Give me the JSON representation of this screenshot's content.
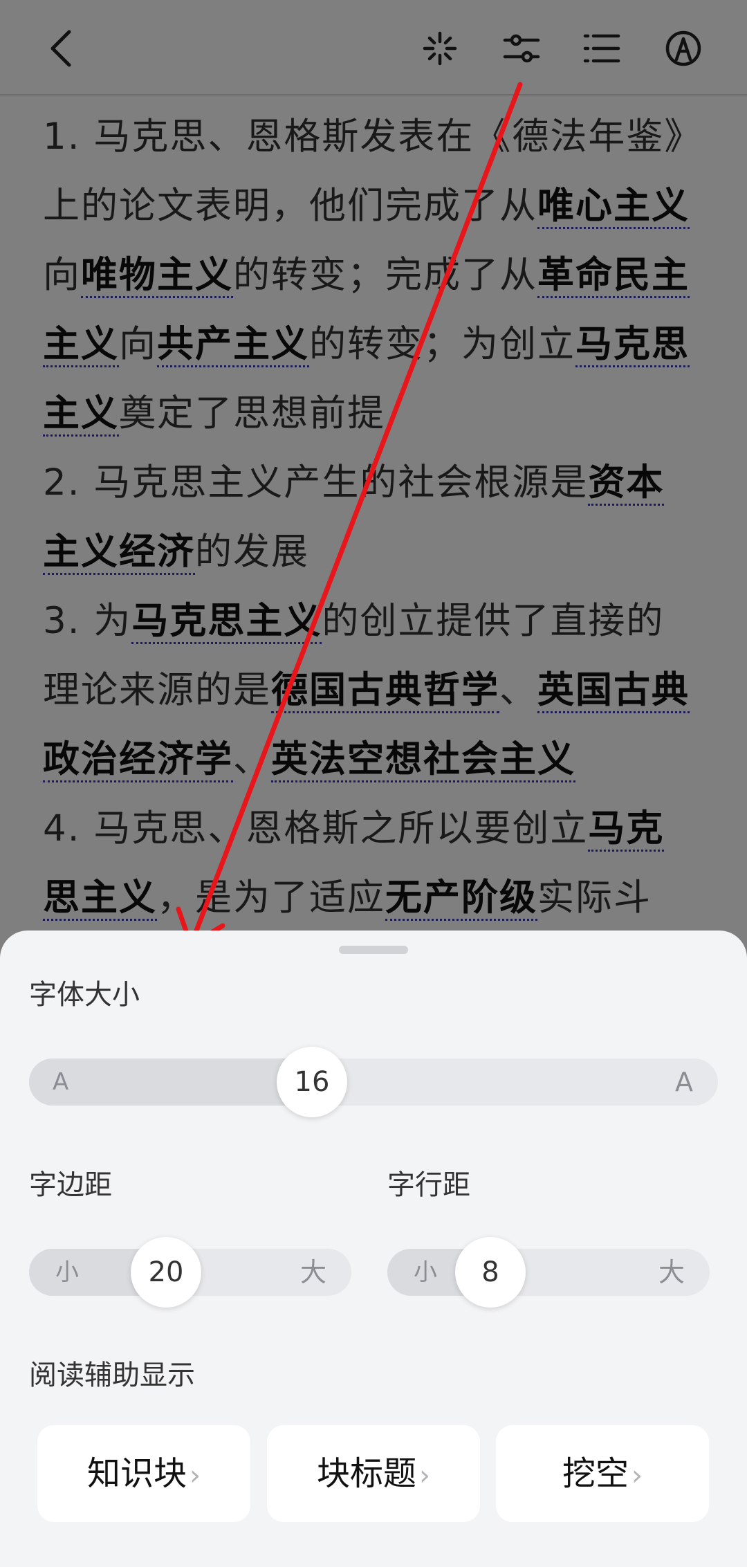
{
  "toolbar": {
    "icons": [
      "back-icon",
      "sparkle-icon",
      "sliders-icon",
      "list-icon",
      "pen-icon"
    ]
  },
  "content": {
    "p1": {
      "t1": "1. 马克思、恩格斯发表在《德法年鉴》上的论文表明，他们完成了从",
      "k1": "唯心主义",
      "t2": "向",
      "k2": "唯物主义",
      "t3": "的转变；完成了从",
      "k3": "革命民主主义",
      "t4": "向",
      "k4": "共产主义",
      "t5": "的转变；为创立",
      "k5": "马克思主义",
      "t6": "奠定了思想前提"
    },
    "p2": {
      "t1": "2. 马克思主义产生的社会根源是",
      "k1": "资本主义经济",
      "t2": "的发展"
    },
    "p3": {
      "t1": "3. 为",
      "k1": "马克思主义",
      "t2": "的创立提供了直接的理论来源的是",
      "k2": "德国古典哲学",
      "t3": "、",
      "k3": "英国古典政治经济学",
      "t4": "、",
      "k4": "英法空想社会主义"
    },
    "p4": {
      "t1": "4. 马克思、恩格斯之所以要创立",
      "k1": "马克思主义",
      "t2": "，是为了适应",
      "k2": "无产阶级",
      "t3": "实际斗"
    }
  },
  "sheet": {
    "font_size_label": "字体大小",
    "font_size": {
      "min_label": "A",
      "max_label": "A",
      "value": "16",
      "fraction": 0.41
    },
    "margin_label": "字边距",
    "margin": {
      "min_label": "小",
      "max_label": "大",
      "value": "20",
      "fraction": 0.42
    },
    "line_spacing_label": "字行距",
    "line_spacing": {
      "min_label": "小",
      "max_label": "大",
      "value": "8",
      "fraction": 0.32
    },
    "assist_label": "阅读辅助显示",
    "cards": [
      {
        "label": "知识块"
      },
      {
        "label": "块标题"
      },
      {
        "label": "挖空"
      }
    ]
  },
  "colors": {
    "annotation_arrow": "#e8151b",
    "keyword_underline": "#3a3aa0"
  }
}
